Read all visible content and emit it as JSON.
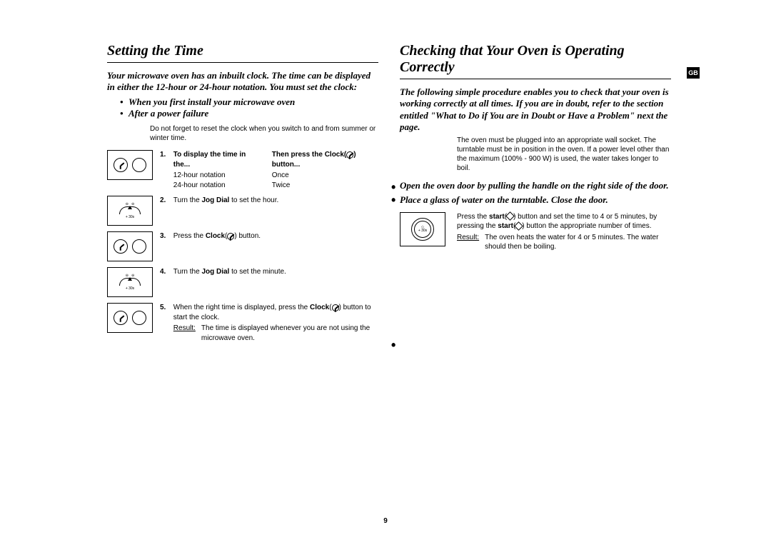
{
  "pageNumber": "9",
  "badge": "GB",
  "left": {
    "heading": "Setting the Time",
    "intro": "Your microwave oven has an inbuilt clock. The time can be displayed in either the 12-hour or 24-hour notation. You must set the clock:",
    "bullets": [
      "When you first install your microwave oven",
      "After a power failure"
    ],
    "note": "Do not forget to reset the clock when you switch to and from summer or winter time.",
    "step1": {
      "num": "1.",
      "colA_head": "To display the time in the...",
      "colA_r1": "12-hour notation",
      "colA_r2": "24-hour notation",
      "colB_head_a": "Then press the Clock(",
      "colB_head_b": ") button...",
      "colB_r1": "Once",
      "colB_r2": "Twice"
    },
    "step2": {
      "num": "2.",
      "text_a": "Turn the ",
      "bold": "Jog Dial",
      "text_b": " to set the hour."
    },
    "step3": {
      "num": "3.",
      "text_a": "Press the ",
      "bold": "Clock",
      "text_b": "(",
      "text_c": ") button."
    },
    "step4": {
      "num": "4.",
      "text_a": "Turn the ",
      "bold": "Jog Dial",
      "text_b": " to set the minute."
    },
    "step5": {
      "num": "5.",
      "text_a": "When the right time is displayed, press the ",
      "bold": "Clock",
      "text_b": "(",
      "text_c": ") button to start the clock.",
      "result_lbl": "Result:",
      "result_txt": "The time is displayed whenever you are not using the microwave oven."
    },
    "dial_label": "+ 30s"
  },
  "right": {
    "heading": "Checking that Your Oven is Operating Correctly",
    "intro": "The following simple procedure enables you to check that your oven is working correctly at all times. If you are in doubt, refer to the section entitled \"What to Do if You are in Doubt or Have a Problem\" next  the page.",
    "note": "The oven must be plugged into an appropriate wall socket. The turntable must be in position in the oven. If a power level other than the maximum (100% - 900 W) is used, the water takes longer to boil.",
    "bullets": [
      "Open the oven door by pulling the handle on the right side of the door.",
      "Place a glass of water on the turntable. Close the door."
    ],
    "step": {
      "a": "Press the ",
      "b": "start",
      "c": "(",
      "d": ") button and set the time to 4 or 5 minutes, by pressing the ",
      "e": "start",
      "f": "(",
      "g": ") button the appropriate number of times.",
      "result_lbl": "Result:",
      "result_txt": "The oven heats the water for 4 or 5 minutes. The water should then be boiling."
    },
    "start_label": "+ 30s"
  }
}
